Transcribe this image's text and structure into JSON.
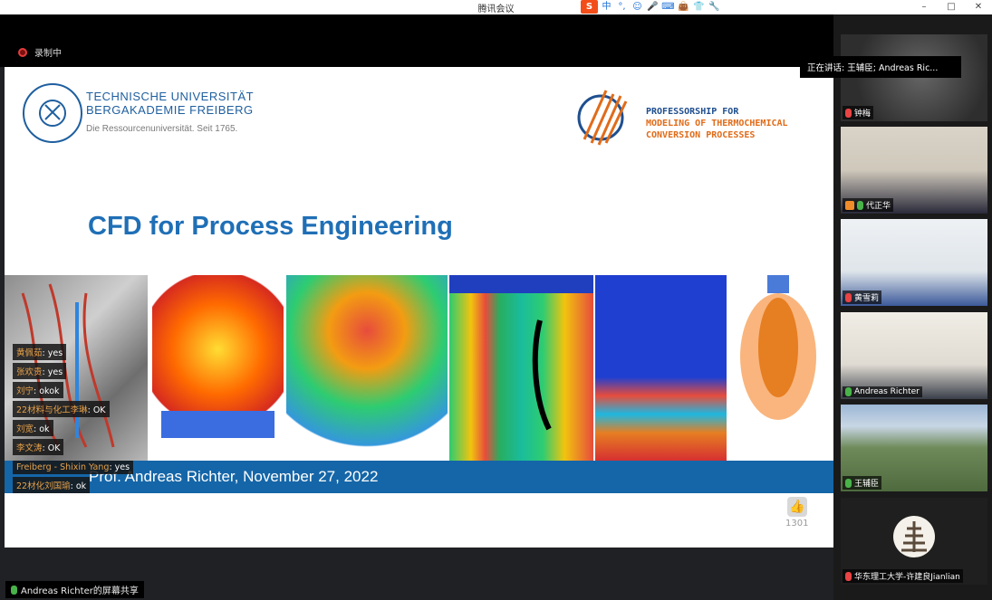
{
  "window": {
    "title": "腾讯会议",
    "ime_logo": "S",
    "ime_items": [
      "中",
      "°,",
      "☺",
      "🎤",
      "⌨",
      "👜",
      "👕",
      "🔧"
    ],
    "controls": [
      "–",
      "□",
      "✕"
    ]
  },
  "recording": {
    "label": "录制中"
  },
  "slide": {
    "university": {
      "line1": "TECHNISCHE UNIVERSITÄT",
      "line2": "BERGAKADEMIE FREIBERG",
      "tagline": "Die Ressourcenuniversität. Seit 1765."
    },
    "professorship": {
      "line1": "PROFESSORSHIP FOR",
      "line2": "MODELING OF THERMOCHEMICAL",
      "line3": "CONVERSION PROCESSES"
    },
    "title": "CFD for Process Engineering",
    "footer": "Prof. Andreas Richter, November 27, 2022",
    "likes": "1301"
  },
  "chat": [
    {
      "name": "黄佩茹",
      "text": "yes"
    },
    {
      "name": "张欢贵",
      "text": "yes"
    },
    {
      "name": "刘宁",
      "text": "okok"
    },
    {
      "name": "22材料与化工李琳",
      "text": "OK"
    },
    {
      "name": "刘宽",
      "text": "ok"
    },
    {
      "name": "李文涛",
      "text": "OK"
    },
    {
      "name": "Freiberg - Shixin Yang",
      "text": "yes"
    },
    {
      "name": "22材化刘国瑜",
      "text": "ok"
    }
  ],
  "share_label": "Andreas Richter的屏幕共享",
  "speaking": "正在讲话: 王辅臣; Andreas Ric...",
  "participants": [
    {
      "name": "钟梅",
      "mic": "muted"
    },
    {
      "name": "代正华",
      "mic": "on"
    },
    {
      "name": "黄雪莉",
      "mic": "muted"
    },
    {
      "name": "Andreas Richter",
      "mic": "on"
    },
    {
      "name": "王辅臣",
      "mic": "on"
    },
    {
      "name": "华东理工大学-许建良Jianlian",
      "mic": "muted"
    }
  ],
  "colors": {
    "tu_blue": "#1f5f9f",
    "title_blue": "#1f6fb6",
    "footer_blue": "#1566a8",
    "accent_orange": "#e06c1a"
  }
}
